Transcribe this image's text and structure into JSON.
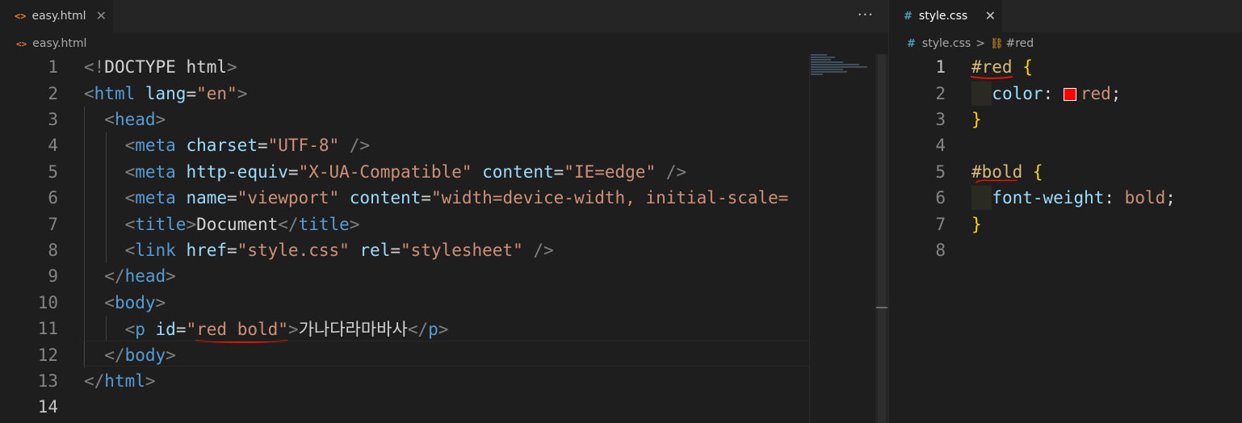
{
  "left_editor": {
    "tab": {
      "icon": "<>",
      "label": "easy.html",
      "close": "✕"
    },
    "more": "···",
    "breadcrumb": {
      "icon": "<>",
      "file": "easy.html"
    },
    "lines": [
      {
        "n": "1"
      },
      {
        "n": "2"
      },
      {
        "n": "3"
      },
      {
        "n": "4"
      },
      {
        "n": "5"
      },
      {
        "n": "6"
      },
      {
        "n": "7"
      },
      {
        "n": "8"
      },
      {
        "n": "9"
      },
      {
        "n": "10"
      },
      {
        "n": "11"
      },
      {
        "n": "12"
      },
      {
        "n": "13"
      },
      {
        "n": "14"
      }
    ],
    "code": {
      "l1": [
        "<!",
        "DOCTYPE html",
        ">"
      ],
      "l2": [
        "<",
        "html",
        " lang",
        "=",
        "\"en\"",
        ">"
      ],
      "l3": [
        "<",
        "head",
        ">"
      ],
      "l4": [
        "<",
        "meta",
        " charset",
        "=",
        "\"UTF-8\"",
        " />"
      ],
      "l5": [
        "<",
        "meta",
        " http-equiv",
        "=",
        "\"X-UA-Compatible\"",
        " content",
        "=",
        "\"IE=edge\"",
        " />"
      ],
      "l6": [
        "<",
        "meta",
        " name",
        "=",
        "\"viewport\"",
        " content",
        "=",
        "\"width=device-width, initial-scale="
      ],
      "l7": [
        "<",
        "title",
        ">",
        "Document",
        "</",
        "title",
        ">"
      ],
      "l8": [
        "<",
        "link",
        " href",
        "=",
        "\"style.css\"",
        " rel",
        "=",
        "\"stylesheet\"",
        " />"
      ],
      "l9": [
        "</",
        "head",
        ">"
      ],
      "l10": [
        "<",
        "body",
        ">"
      ],
      "l11": [
        "<",
        "p",
        " id",
        "=",
        "\"red bold\"",
        ">",
        "가나다라마바사",
        "</",
        "p",
        ">"
      ],
      "l12": [
        "</",
        "body",
        ">"
      ],
      "l13": [
        "</",
        "html",
        ">"
      ]
    }
  },
  "right_editor": {
    "tab": {
      "icon": "#",
      "label": "style.css",
      "close": "✕"
    },
    "breadcrumb": {
      "icon": "#",
      "file": "style.css",
      "separator": ">",
      "symbol": "#red"
    },
    "lines": [
      {
        "n": "1"
      },
      {
        "n": "2"
      },
      {
        "n": "3"
      },
      {
        "n": "4"
      },
      {
        "n": "5"
      },
      {
        "n": "6"
      },
      {
        "n": "7"
      },
      {
        "n": "8"
      }
    ],
    "code": {
      "l1": [
        "#red",
        " ",
        "{"
      ],
      "l2": [
        "color",
        ": ",
        "red",
        ";"
      ],
      "l3": [
        "}"
      ],
      "l5": [
        "#bold",
        " ",
        "{"
      ],
      "l6": [
        "font-weight",
        ": ",
        "bold",
        ";"
      ],
      "l7": [
        "}"
      ]
    },
    "swatch_color": "#ff0000"
  },
  "colors": {
    "background": "#1e1e1e",
    "tag": "#569cd6",
    "attribute": "#9cdcfe",
    "string": "#ce9178",
    "selector": "#d7ba7d",
    "brace": "#ffd700",
    "squiggle": "#e51400"
  },
  "icons": {
    "html_file": "html-file-icon",
    "css_file": "css-file-icon",
    "close": "close-icon",
    "more": "more-actions-icon",
    "symbol": "css-symbol-icon"
  }
}
